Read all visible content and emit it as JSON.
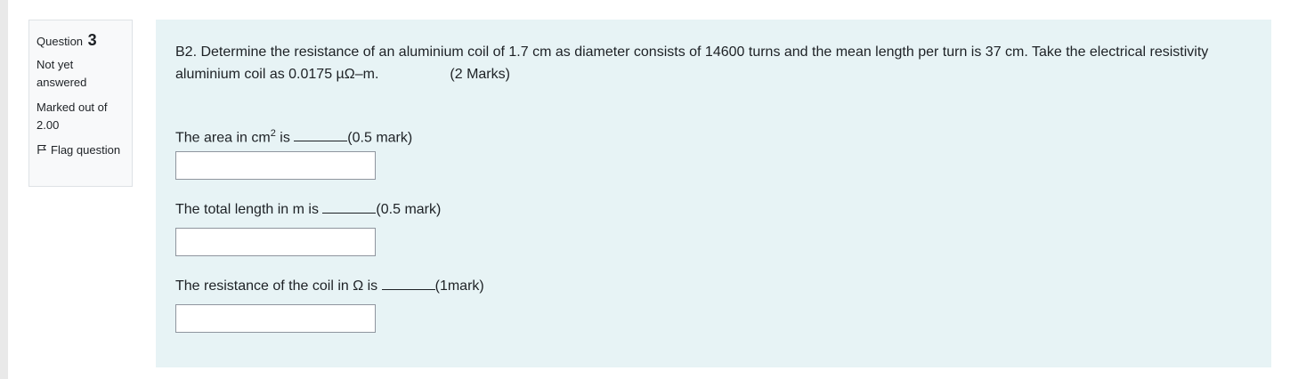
{
  "info": {
    "question_label": "Question",
    "question_number": "3",
    "state": "Not yet answered",
    "grade": "Marked out of 2.00",
    "flag_label": "Flag question"
  },
  "question": {
    "text": "B2. Determine the resistance of an aluminium coil of 1.7 cm as diameter consists of 14600 turns and the mean length per turn is 37 cm. Take the electrical resistivity aluminium coil as 0.0175 µΩ–m.",
    "marks": "(2 Marks)"
  },
  "parts": [
    {
      "prefix": "The area in cm",
      "sup": "2",
      "suffix": " is ",
      "mark": "(0.5 mark)",
      "value": ""
    },
    {
      "prefix": "The total length in m is ",
      "sup": "",
      "suffix": "",
      "mark": "(0.5 mark)",
      "value": ""
    },
    {
      "prefix": "The resistance of the coil in Ω is ",
      "sup": "",
      "suffix": "",
      "mark": "(1mark)",
      "value": ""
    }
  ],
  "colors": {
    "content_bg": "#e7f3f5",
    "info_bg": "#f8f9fa",
    "text": "#1d2125"
  },
  "icons": {
    "flag": "flag-icon"
  }
}
